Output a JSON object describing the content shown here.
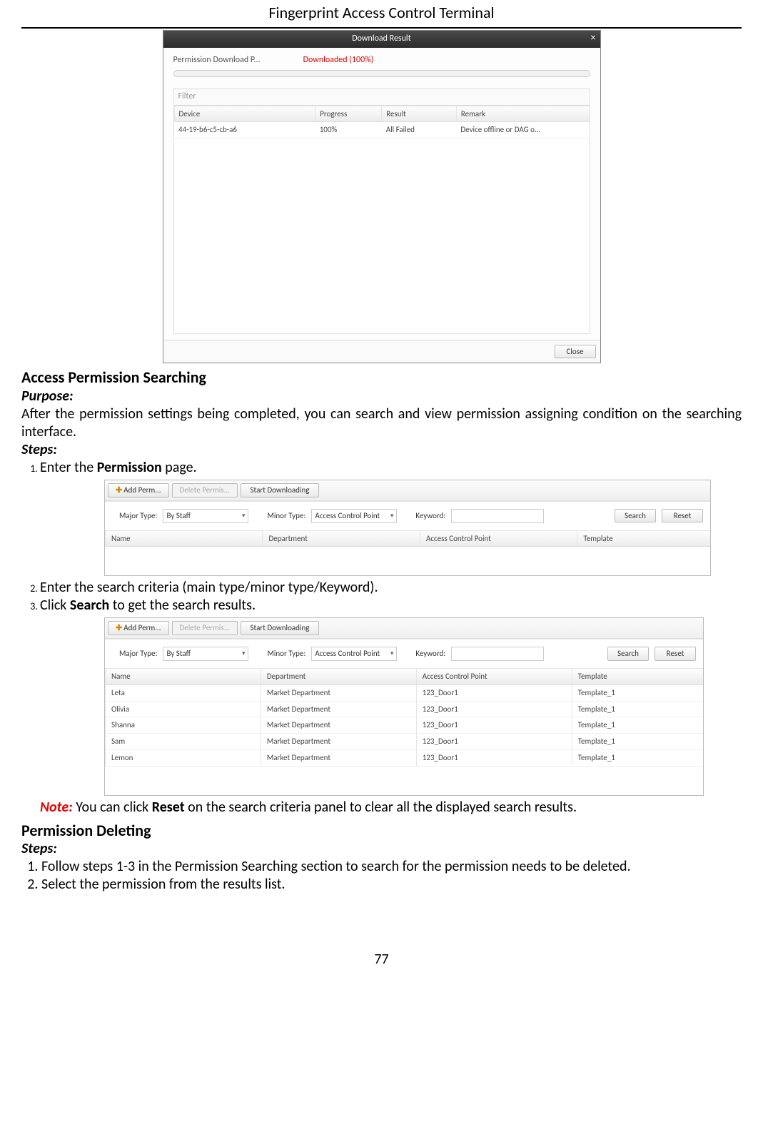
{
  "doc": {
    "title": "Fingerprint Access Control Terminal",
    "page_number": "77"
  },
  "dialog": {
    "title": "Download Result",
    "perm_label": "Permission Download P...",
    "status": "Downloaded (100%)",
    "filter_placeholder": "Filter",
    "cols": {
      "device": "Device",
      "progress": "Progress",
      "result": "Result",
      "remark": "Remark"
    },
    "row": {
      "device": "44-19-b6-c5-cb-a6",
      "progress": "100%",
      "result": "All Failed",
      "remark": "Device offline or DAG o..."
    },
    "close": "Close"
  },
  "s1": {
    "heading": "Access Permission Searching",
    "purpose_label": "Purpose:",
    "purpose_text": "After the permission settings being completed, you can search and view permission assigning condition on the searching interface.",
    "steps_label": "Steps:",
    "step1a": "Enter the ",
    "step1b": "Permission",
    "step1c": " page.",
    "step2": "Enter the search criteria (main type/minor type/Keyword).",
    "step3a": "Click ",
    "step3b": "Search",
    "step3c": " to get the search results.",
    "note_label": "Note:",
    "note_a": " You can click ",
    "note_b": "Reset",
    "note_c": " on the search criteria panel to clear all the displayed search results."
  },
  "s2": {
    "heading": "Permission Deleting",
    "steps_label": "Steps:",
    "step1": "Follow steps 1-3 in the Permission Searching section to search for the permission needs to be deleted.",
    "step2": "Select the permission from the results list."
  },
  "ui": {
    "add": "Add Perm...",
    "del": "Delete Permis...",
    "start": "Start Downloading",
    "major": "Major Type:",
    "majorval": "By Staff",
    "minor": "Minor Type:",
    "minorval": "Access Control Point",
    "keyword": "Keyword:",
    "search": "Search",
    "reset": "Reset",
    "cols": {
      "name": "Name",
      "dept": "Department",
      "acp": "Access Control Point",
      "tpl": "Template"
    },
    "rows": [
      {
        "name": "Leta",
        "dept": "Market Department",
        "acp": "123_Door1",
        "tpl": "Template_1"
      },
      {
        "name": "Olivia",
        "dept": "Market Department",
        "acp": "123_Door1",
        "tpl": "Template_1"
      },
      {
        "name": "Shanna",
        "dept": "Market Department",
        "acp": "123_Door1",
        "tpl": "Template_1"
      },
      {
        "name": "Sam",
        "dept": "Market Department",
        "acp": "123_Door1",
        "tpl": "Template_1"
      },
      {
        "name": "Lemon",
        "dept": "Market Department",
        "acp": "123_Door1",
        "tpl": "Template_1"
      }
    ]
  }
}
